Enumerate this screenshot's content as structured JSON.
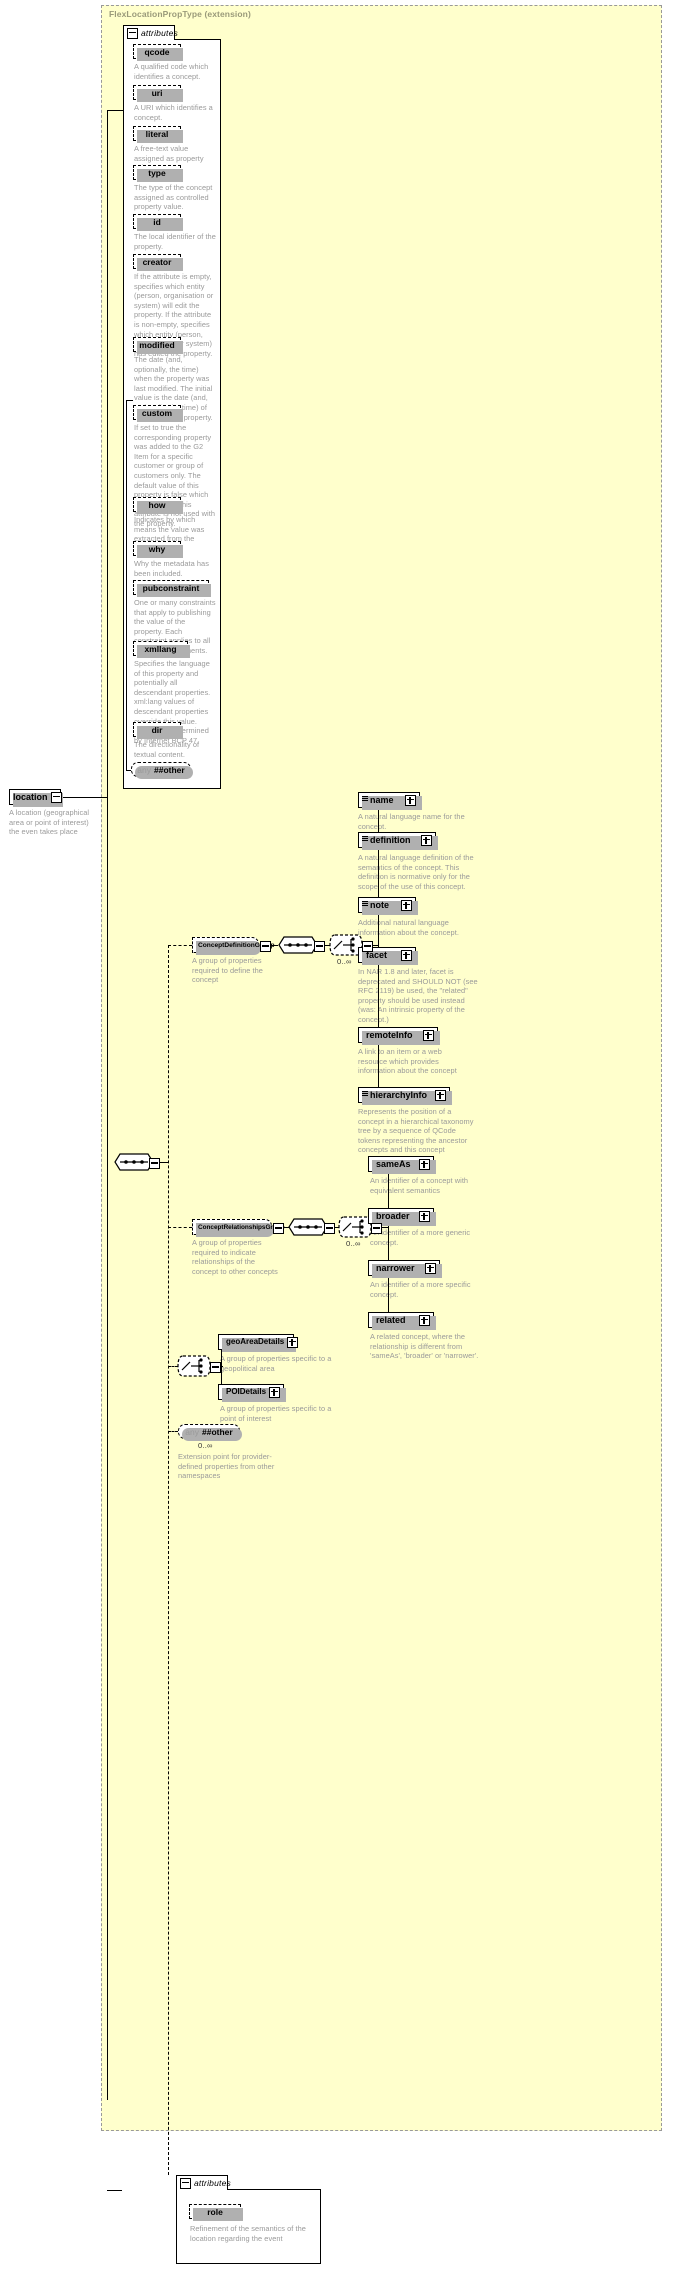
{
  "diagram": {
    "type": "xsd-schema-diagram",
    "extension_title": "FlexLocationPropType (extension)",
    "root_element": {
      "name": "location",
      "doc": "A location (geographical area or point of interest) the even takes place",
      "toggle": "minus"
    },
    "attributes_tab_label": "attributes",
    "colors": {
      "panel_bg": "#ffffcc",
      "panel_border": "#999999",
      "doc_text": "#9a9a9a",
      "title_text": "#9a9a7a",
      "box_bg": "#ffffff",
      "line": "#000000",
      "shadow": "#b0b0b0"
    },
    "attributes": [
      {
        "name": "qcode",
        "doc": "A qualified code which identifies a concept."
      },
      {
        "name": "uri",
        "doc": "A URI which identifies a concept."
      },
      {
        "name": "literal",
        "doc": "A free-text value assigned as property value."
      },
      {
        "name": "type",
        "doc": "The type of the concept assigned as controlled property value."
      },
      {
        "name": "id",
        "doc": "The local identifier of the property."
      },
      {
        "name": "creator",
        "doc": "If the attribute is empty, specifies which entity (person, organisation or system) will edit the property. If the attribute is non-empty, specifies which entity (person, organisation or system) has edited the property."
      },
      {
        "name": "modified",
        "doc": "The date (and, optionally, the time) when the property was last modified. The initial value is the date (and, optionally, the time) of creation of the property."
      },
      {
        "name": "custom",
        "doc": "If set to true the corresponding property was added to the G2 Item for a specific customer or group of customers only. The default value of this property is false which applies when this attribute is not used with the property."
      },
      {
        "name": "how",
        "doc": "Indicates by which means the value was extracted from the content."
      },
      {
        "name": "why",
        "doc": "Why the metadata has been included."
      },
      {
        "name": "pubconstraint",
        "doc": "One or many constraints that apply to publishing the value of the property. Each constraint applies to all descendant elements."
      },
      {
        "name": "xmllang",
        "doc": "Specifies the language of this property and potentially all descendant properties. xml:lang values of descendant properties override this value. Values are determined by Internet BCP 47."
      },
      {
        "name": "dir",
        "doc": "The directionality of textual content."
      }
    ],
    "attributes_any": {
      "keyword": "any",
      "namespace": "##other"
    },
    "groups": [
      {
        "name": "ConceptDefinitionGroup",
        "doc": "A group of properties required to define the concept",
        "occurrence": "0..∞",
        "children": [
          {
            "name": "name",
            "doc": "A natural language name for the concept.",
            "has_lines_icon": true
          },
          {
            "name": "definition",
            "doc": "A natural language definition of the semantics of the concept. This definition is normative only for the scope of the use of this concept.",
            "has_lines_icon": true
          },
          {
            "name": "note",
            "doc": "Additional natural language information about the concept.",
            "has_lines_icon": true
          },
          {
            "name": "facet",
            "doc": "In NAR 1.8 and later, facet is deprecated and SHOULD NOT (see RFC 2119) be used, the \"related\" property should be used instead (was: An intrinsic property of the concept.)",
            "has_lines_icon": false
          },
          {
            "name": "remoteInfo",
            "doc": "A link to an item or a web resource which provides information about the concept",
            "has_lines_icon": false
          },
          {
            "name": "hierarchyInfo",
            "doc": "Represents the position of a concept in a hierarchical taxonomy tree by a sequence of QCode tokens representing the ancestor concepts and this concept",
            "has_lines_icon": true
          }
        ]
      },
      {
        "name": "ConceptRelationshipsGroup",
        "doc": "A group of properties required to indicate relationships of the concept to other concepts",
        "occurrence": "0..∞",
        "children": [
          {
            "name": "sameAs",
            "doc": "An identifier of a concept with equivalent semantics",
            "has_lines_icon": false
          },
          {
            "name": "broader",
            "doc": "An identifier of a more generic concept.",
            "has_lines_icon": false
          },
          {
            "name": "narrower",
            "doc": "An identifier of a more specific concept.",
            "has_lines_icon": false
          },
          {
            "name": "related",
            "doc": "A related concept, where the relationship is different from 'sameAs', 'broader' or 'narrower'.",
            "has_lines_icon": false
          }
        ]
      }
    ],
    "choice_details": [
      {
        "name": "geoAreaDetails",
        "doc": "A group of properties specific to a geopolitical area"
      },
      {
        "name": "POIDetails",
        "doc": "A group of properties specific to a point of interest"
      }
    ],
    "extension_any": {
      "keyword": "any",
      "namespace": "##other",
      "occurrence": "0..∞",
      "doc": "Extension point for provider-defined properties from other namespaces"
    },
    "bottom_attributes": {
      "tab_label": "attributes",
      "items": [
        {
          "name": "role",
          "doc": "Refinement of the semantics of the location regarding the event"
        }
      ]
    }
  }
}
